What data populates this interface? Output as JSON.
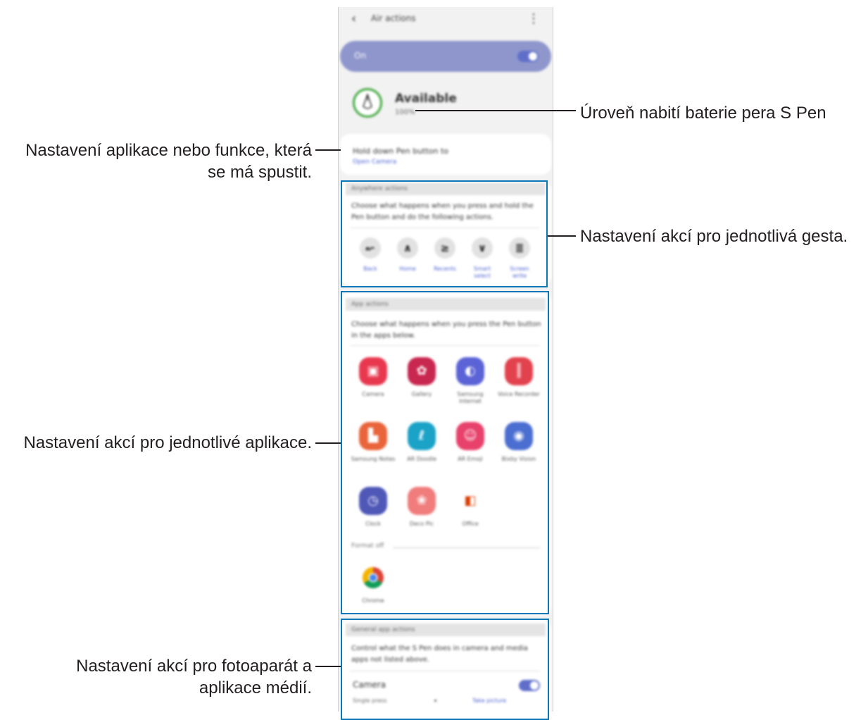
{
  "annotations": {
    "battery": "Úroveň nabití baterie pera S Pen",
    "app_setting_line1": "Nastavení aplikace nebo funkce, která",
    "app_setting_line2": "se má spustit.",
    "gestures": "Nastavení akcí pro jednotlivá gesta.",
    "apps": "Nastavení akcí pro jednotlivé aplikace.",
    "camera_line1": "Nastavení akcí pro fotoaparát a",
    "camera_line2": "aplikace médií."
  },
  "phone": {
    "title": "Air actions",
    "on_label": "On",
    "status_title": "Available",
    "status_sub": "100%",
    "hold_title": "Hold down Pen button to",
    "hold_sub": "Open Camera",
    "gestures_header": "Anywhere actions",
    "gestures_desc": "Choose what happens when you press and hold the Pen button and do the following actions.",
    "gestures": [
      {
        "label": "Back",
        "glyph": "↜"
      },
      {
        "label": "Home",
        "glyph": "∧"
      },
      {
        "label": "Recents",
        "glyph": "≥"
      },
      {
        "label": "Smart select",
        "glyph": "∨"
      },
      {
        "label": "Screen write",
        "glyph": "≣"
      }
    ],
    "apps_header": "App actions",
    "apps_desc": "Choose what happens when you press the Pen button in the apps below.",
    "apps": [
      {
        "label": "Camera",
        "color": "#e8384f",
        "glyph": "▣"
      },
      {
        "label": "Gallery",
        "color": "#c8274f",
        "glyph": "✿"
      },
      {
        "label": "Samsung Internet",
        "color": "#5b63d6",
        "glyph": "◐"
      },
      {
        "label": "Voice Recorder",
        "color": "#e2424e",
        "glyph": "║"
      },
      {
        "label": "Samsung Notes",
        "color": "#e9643a",
        "glyph": "▙"
      },
      {
        "label": "AR Doodle",
        "color": "#1aa2c7",
        "glyph": "ℓ"
      },
      {
        "label": "AR Emoji",
        "color": "#e8416b",
        "glyph": "☺"
      },
      {
        "label": "Bixby Vision",
        "color": "#4b6ed1",
        "glyph": "◉"
      },
      {
        "label": "Clock",
        "color": "#4f58b7",
        "glyph": "◷"
      },
      {
        "label": "Deco Pic",
        "color": "#f07c7c",
        "glyph": "❀"
      },
      {
        "label": "Office",
        "color": "#ffffff",
        "glyph": "◧"
      }
    ],
    "format_label": "Format off",
    "extra_app": {
      "label": "Chrome"
    },
    "general_header": "General app actions",
    "general_desc": "Control what the S Pen does in camera and media apps not listed above.",
    "camera_title": "Camera",
    "camera_sub": "Single press",
    "camera_action": "Take picture"
  }
}
